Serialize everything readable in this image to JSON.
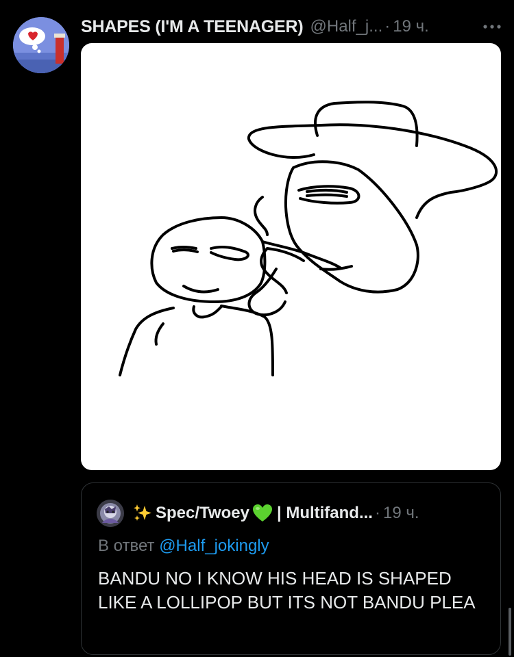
{
  "tweet": {
    "display_name": "SHAPES (I'M A TEENAGER)",
    "handle": "@Half_j...",
    "separator": "·",
    "time": "19 ч."
  },
  "quote": {
    "display_name": "Spec/Twoey",
    "name_suffix": "| Multifand...",
    "separator": "·",
    "time": "19 ч.",
    "reply_prefix": "В ответ",
    "reply_to": "@Half_jokingly",
    "text": "BANDU NO I KNOW HIS HEAD IS SHAPED LIKE A LOLLIPOP BUT ITS NOT BANDU PLEA"
  },
  "icons": {
    "more": "more-dots-icon",
    "sparkles": "sparkles-emoji-icon",
    "heart": "green-heart-emoji-icon"
  },
  "colors": {
    "background": "#000000",
    "text": "#e7e9ea",
    "muted": "#71767b",
    "link": "#1d9bf0",
    "border": "#2f3336",
    "green_heart": "#5bd12f"
  }
}
